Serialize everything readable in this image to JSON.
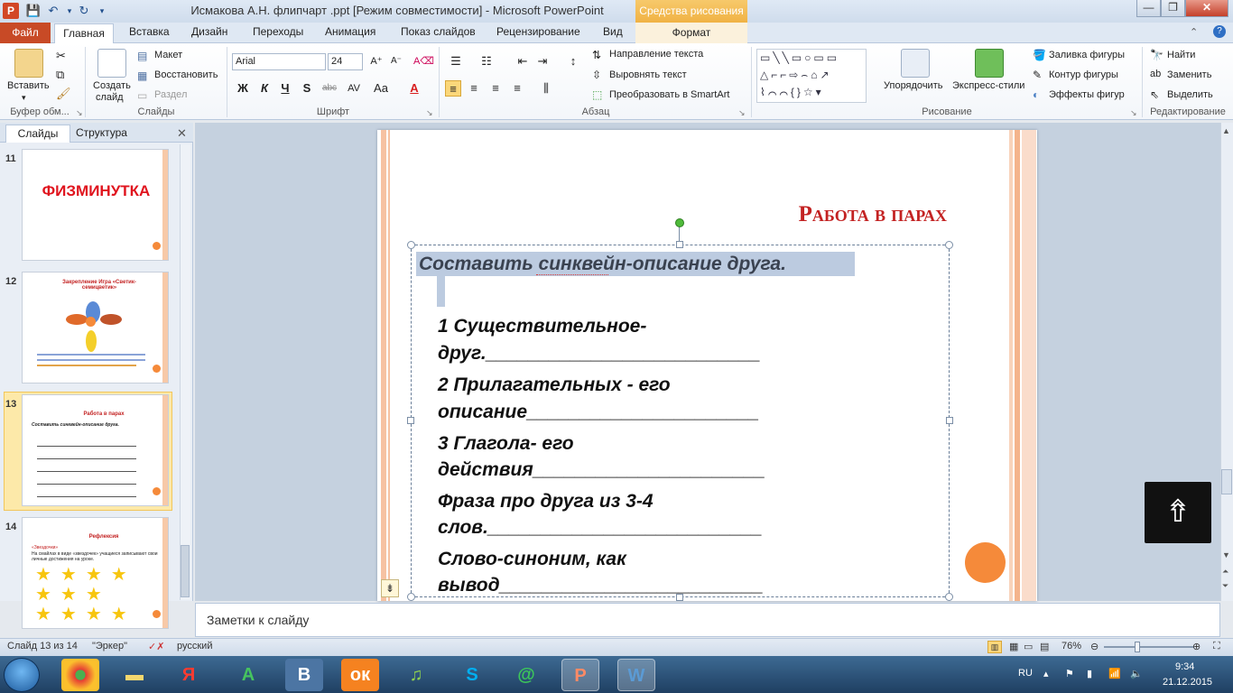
{
  "window": {
    "title": "Исмакова А.Н. флипчарт .ppt [Режим совместимости]  -  Microsoft PowerPoint",
    "context_tab_header": "Средства рисования",
    "app_icon": "P"
  },
  "tabs": {
    "file": "Файл",
    "items": [
      "Главная",
      "Вставка",
      "Дизайн",
      "Переходы",
      "Анимация",
      "Показ слайдов",
      "Рецензирование",
      "Вид"
    ],
    "format": "Формат"
  },
  "ribbon": {
    "clipboard": {
      "paste": "Вставить",
      "group": "Буфер обм..."
    },
    "slides": {
      "new_slide_1": "Создать",
      "new_slide_2": "слайд",
      "layout": "Макет",
      "reset": "Восстановить",
      "section": "Раздел",
      "group": "Слайды"
    },
    "font": {
      "name": "Arial",
      "size": "24",
      "group": "Шрифт",
      "bold": "Ж",
      "italic": "К",
      "underline": "Ч",
      "shadow": "S",
      "strike": "abc",
      "spacing": "AV",
      "case": "Aa",
      "color": "A"
    },
    "paragraph": {
      "text_direction": "Направление текста",
      "align_text": "Выровнять текст",
      "smartart": "Преобразовать в SmartArt",
      "group": "Абзац"
    },
    "drawing": {
      "shapes_glyphs": "▭╲╲▭○▭▭ △⌐⌐⇨⌢⌂↗ ⌇⌒⌒{}☆▾",
      "arrange": "Упорядочить",
      "quick_styles": "Экспресс-стили",
      "fill": "Заливка фигуры",
      "outline": "Контур фигуры",
      "effects": "Эффекты фигур",
      "group": "Рисование"
    },
    "editing": {
      "find": "Найти",
      "replace": "Заменить",
      "select": "Выделить",
      "group": "Редактирование"
    }
  },
  "left_panel": {
    "tab_slides": "Слайды",
    "tab_outline": "Структура",
    "thumbnails": [
      {
        "num": "11",
        "title": "ФИЗМИНУТКА"
      },
      {
        "num": "12",
        "title": "Закрепление Игра «Светик-семицветик»"
      },
      {
        "num": "13",
        "title": "Работа в парах",
        "intro": "Составить  синквейн-описание  друга."
      },
      {
        "num": "14",
        "title": "Рефлексия",
        "subtitle": "«Звездочки»",
        "text": "На смайлах в виде «звездочек» учащиеся записывают свои личные достижения на уроке."
      }
    ]
  },
  "slide": {
    "title": "Работа в парах",
    "intro": "Составить  синквейн-описание  друга.",
    "items": [
      {
        "line1": "1 Существительное-",
        "line2": "друг.__________________________"
      },
      {
        "line1": "2 Прилагательных  - его",
        "line2": "описание______________________"
      },
      {
        "line1": "3 Глагола-  его",
        "line2": "действия______________________"
      },
      {
        "line1": "Фраза про друга из 3-4",
        "line2": "слов.__________________________"
      },
      {
        "line1": "Слово-синоним,  как",
        "line2": "вывод_________________________"
      }
    ]
  },
  "notes": {
    "placeholder": "Заметки к слайду"
  },
  "statusbar": {
    "slide_pos": "Слайд 13 из 14",
    "theme": "\"Эркер\"",
    "language": "русский",
    "zoom": "76%",
    "zoom_fraction": 0.76
  },
  "taskbar": {
    "lang": "RU",
    "time": "9:34",
    "date": "21.12.2015",
    "apps": [
      "chrome",
      "explorer",
      "yandex",
      "agent",
      "vk",
      "odnoklassniki",
      "music",
      "skype",
      "mail",
      "powerpoint",
      "word"
    ]
  },
  "colors": {
    "accent_orange": "#f58a3a",
    "title_red": "#c32222",
    "file_tab": "#c84a26",
    "context_tab": "#f0b244"
  }
}
